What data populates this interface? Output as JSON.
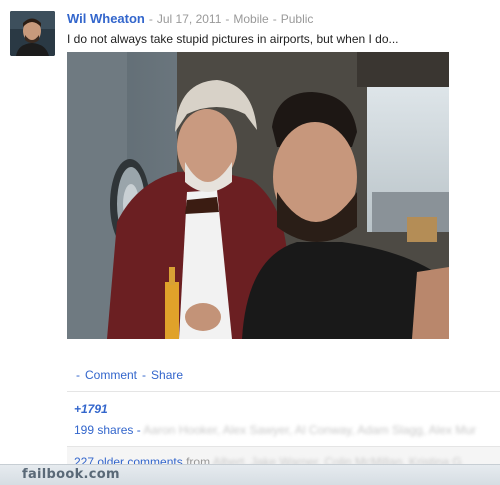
{
  "post": {
    "author": "Wil Wheaton",
    "date": "Jul 17, 2011",
    "source": "Mobile",
    "visibility": "Public",
    "separator": "-",
    "text": "I do not always take stupid pictures in airports, but when I do..."
  },
  "actions": {
    "comment_label": "Comment",
    "share_label": "Share",
    "dash": "-"
  },
  "plus_one": "+1791",
  "shares": {
    "count_label": "199 shares",
    "dash": "-",
    "names": "Aaron Hooker, Alex Sawyer, Al Conway, Adam Slagg, Alex Mur"
  },
  "comments": {
    "older_label": "227 older comments",
    "from_label": "from",
    "names": "Albert, Jake Warner, Colin McMillan, Kristina G"
  },
  "watermark": "failbook.com"
}
